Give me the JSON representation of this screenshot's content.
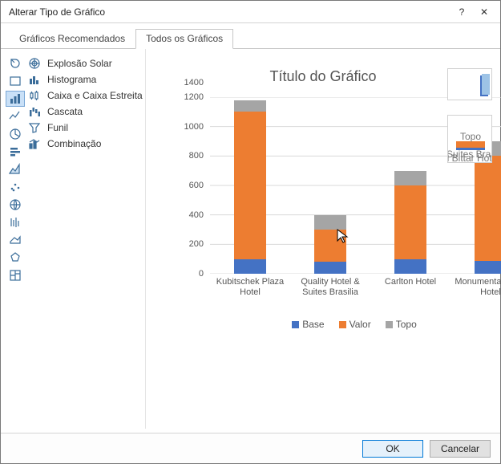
{
  "window": {
    "title": "Alterar Tipo de Gráfico",
    "help_label": "?",
    "close_label": "✕"
  },
  "tabs": {
    "recommended": "Gráficos Recomendados",
    "all": "Todos os Gráficos"
  },
  "chart_types": {
    "sunburst": "Explosão Solar",
    "histogram": "Histograma",
    "box": "Caixa e Caixa Estreita",
    "waterfall": "Cascata",
    "funnel": "Funil",
    "combo": "Combinação"
  },
  "buttons": {
    "ok": "OK",
    "cancel": "Cancelar"
  },
  "chart_data": {
    "type": "bar",
    "stacked": true,
    "title": "Título do Gráfico",
    "xlabel": "",
    "ylabel": "",
    "ylim": [
      0,
      1200
    ],
    "yticks": [
      0,
      200,
      400,
      600,
      800,
      1000,
      1200,
      1400
    ],
    "categories": [
      "Kubitschek Plaza Hotel",
      "Quality Hotel & Suites Brasilia",
      "Carlton Hotel",
      "Monumental Bittar Hotel"
    ],
    "series": [
      {
        "name": "Base",
        "color": "#4472c4",
        "values": [
          100,
          80,
          100,
          90
        ]
      },
      {
        "name": "Valor",
        "color": "#ed7d31",
        "values": [
          1000,
          220,
          500,
          710
        ]
      },
      {
        "name": "Topo",
        "color": "#a5a5a5",
        "values": [
          80,
          100,
          100,
          100
        ]
      }
    ],
    "legend_position": "bottom"
  }
}
